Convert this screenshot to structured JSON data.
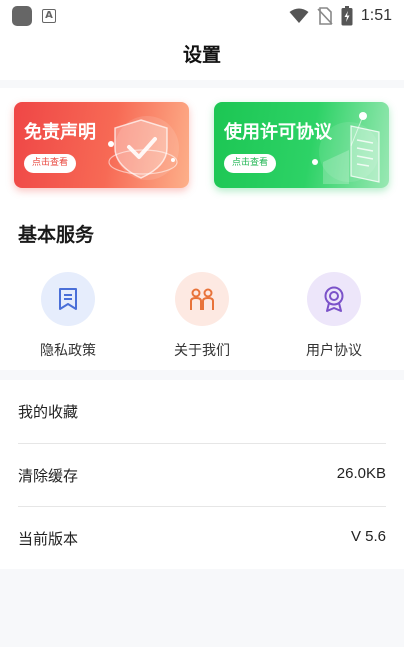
{
  "status_bar": {
    "time": "1:51"
  },
  "header": {
    "title": "设置"
  },
  "banners": [
    {
      "title": "免责声明",
      "button": "点击查看",
      "icon": "shield-check-icon"
    },
    {
      "title": "使用许可协议",
      "button": "点击查看",
      "icon": "document-icon"
    }
  ],
  "services": {
    "title": "基本服务",
    "items": [
      {
        "label": "隐私政策",
        "icon": "bookmark-icon",
        "color": "#4a6fd8"
      },
      {
        "label": "关于我们",
        "icon": "people-icon",
        "color": "#e8733a"
      },
      {
        "label": "用户协议",
        "icon": "badge-icon",
        "color": "#7b52c9"
      }
    ]
  },
  "list": [
    {
      "label": "我的收藏",
      "value": ""
    },
    {
      "label": "清除缓存",
      "value": "26.0KB"
    },
    {
      "label": "当前版本",
      "value": "V 5.6"
    }
  ]
}
